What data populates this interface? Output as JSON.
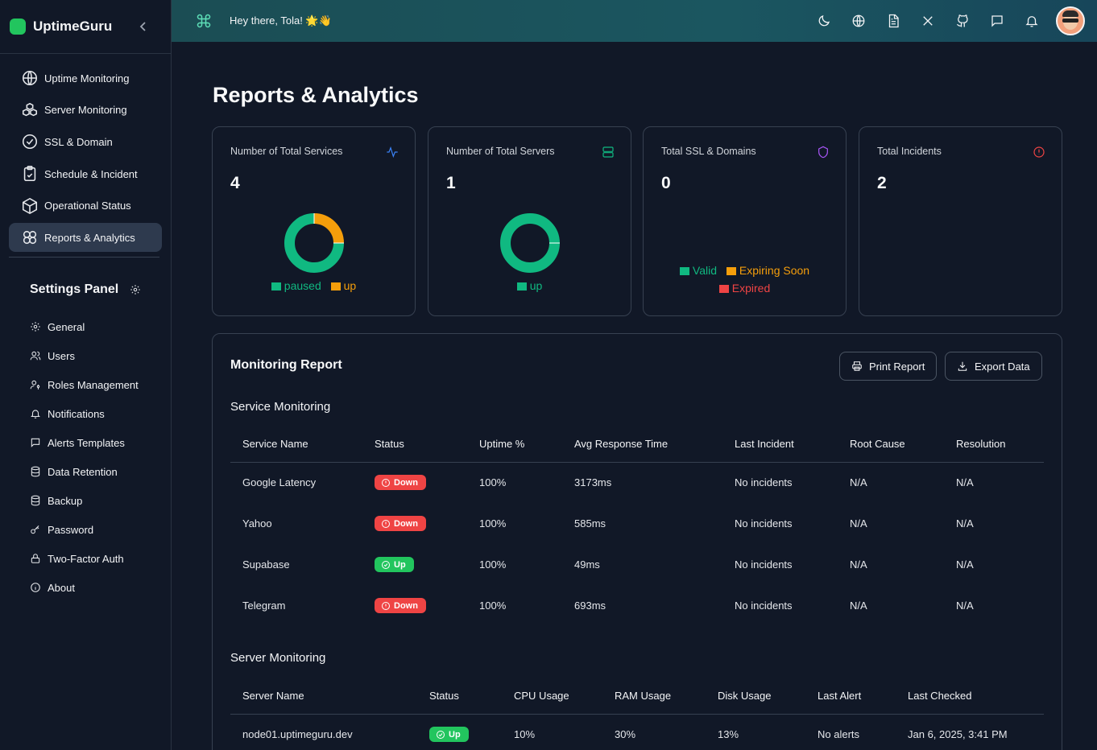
{
  "app": {
    "name": "UptimeGuru"
  },
  "nav": {
    "items": [
      {
        "label": "Uptime Monitoring",
        "icon": "globe-icon"
      },
      {
        "label": "Server Monitoring",
        "icon": "boxes-icon"
      },
      {
        "label": "SSL & Domain",
        "icon": "badge-check-icon"
      },
      {
        "label": "Schedule & Incident",
        "icon": "clipboard-icon"
      },
      {
        "label": "Operational Status",
        "icon": "package-icon"
      },
      {
        "label": "Reports & Analytics",
        "icon": "chart-icon",
        "active": true
      }
    ]
  },
  "settings": {
    "title": "Settings Panel",
    "items": [
      {
        "label": "General",
        "icon": "gear-icon"
      },
      {
        "label": "Users",
        "icon": "users-icon"
      },
      {
        "label": "Roles Management",
        "icon": "user-key-icon"
      },
      {
        "label": "Notifications",
        "icon": "bell-icon"
      },
      {
        "label": "Alerts Templates",
        "icon": "message-icon"
      },
      {
        "label": "Data Retention",
        "icon": "database-icon"
      },
      {
        "label": "Backup",
        "icon": "database-icon"
      },
      {
        "label": "Password",
        "icon": "key-icon"
      },
      {
        "label": "Two-Factor Auth",
        "icon": "lock-icon"
      },
      {
        "label": "About",
        "icon": "info-icon"
      }
    ]
  },
  "topbar": {
    "greeting": "Hey there, Tola! 🌟👋"
  },
  "page": {
    "title": "Reports & Analytics"
  },
  "cards": [
    {
      "label": "Number of Total Services",
      "value": "4",
      "legend": [
        "paused",
        "up"
      ],
      "icon": "activity-icon"
    },
    {
      "label": "Number of Total Servers",
      "value": "1",
      "legend": [
        "up"
      ],
      "icon": "server-icon"
    },
    {
      "label": "Total SSL & Domains",
      "value": "0",
      "legend": [
        "Valid",
        "Expiring Soon",
        "Expired"
      ],
      "icon": "shield-icon"
    },
    {
      "label": "Total Incidents",
      "value": "2",
      "icon": "alert-circle-icon"
    }
  ],
  "colors": {
    "paused": "#10b981",
    "up_orange": "#f59e0b",
    "valid": "#10b981",
    "expiring": "#f59e0b",
    "expired": "#ef4444",
    "down": "#ef4444",
    "up": "#22c55e"
  },
  "chart_data": [
    {
      "type": "pie",
      "title": "Number of Total Services",
      "categories": [
        "paused",
        "up"
      ],
      "values": [
        3,
        1
      ]
    },
    {
      "type": "pie",
      "title": "Number of Total Servers",
      "categories": [
        "up"
      ],
      "values": [
        1
      ]
    }
  ],
  "report": {
    "title": "Monitoring Report",
    "print_label": "Print Report",
    "export_label": "Export Data",
    "service_title": "Service Monitoring",
    "service_headers": [
      "Service Name",
      "Status",
      "Uptime %",
      "Avg Response Time",
      "Last Incident",
      "Root Cause",
      "Resolution"
    ],
    "service_rows": [
      {
        "name": "Google Latency",
        "status": "Down",
        "uptime": "100%",
        "avg": "3173ms",
        "incident": "No incidents",
        "cause": "N/A",
        "resolution": "N/A"
      },
      {
        "name": "Yahoo",
        "status": "Down",
        "uptime": "100%",
        "avg": "585ms",
        "incident": "No incidents",
        "cause": "N/A",
        "resolution": "N/A"
      },
      {
        "name": "Supabase",
        "status": "Up",
        "uptime": "100%",
        "avg": "49ms",
        "incident": "No incidents",
        "cause": "N/A",
        "resolution": "N/A"
      },
      {
        "name": "Telegram",
        "status": "Down",
        "uptime": "100%",
        "avg": "693ms",
        "incident": "No incidents",
        "cause": "N/A",
        "resolution": "N/A"
      }
    ],
    "server_title": "Server Monitoring",
    "server_headers": [
      "Server Name",
      "Status",
      "CPU Usage",
      "RAM Usage",
      "Disk Usage",
      "Last Alert",
      "Last Checked"
    ],
    "server_rows": [
      {
        "name": "node01.uptimeguru.dev",
        "status": "Up",
        "cpu": "10%",
        "ram": "30%",
        "disk": "13%",
        "alert": "No alerts",
        "checked": "Jan 6, 2025, 3:41 PM"
      }
    ]
  }
}
